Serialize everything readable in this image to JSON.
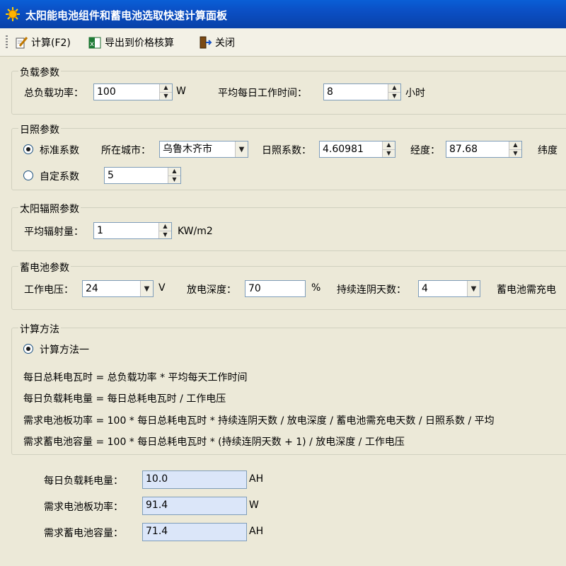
{
  "window": {
    "title": "太阳能电池组件和蓄电池选取快速计算面板"
  },
  "toolbar": {
    "calc_label": "计算(F2)",
    "export_label": "导出到价格核算",
    "close_label": "关闭"
  },
  "load": {
    "group_title": "负载参数",
    "total_power_label": "总负载功率：",
    "total_power_value": "100",
    "total_power_unit": "W",
    "daily_hours_label": "平均每日工作时间：",
    "daily_hours_value": "8",
    "daily_hours_unit": "小时"
  },
  "sunshine": {
    "group_title": "日照参数",
    "standard_label": "标准系数",
    "city_label": "所在城市：",
    "city_value": "乌鲁木齐市",
    "coef_label": "日照系数：",
    "coef_value": "4.60981",
    "longitude_label": "经度：",
    "longitude_value": "87.68",
    "latitude_label": "纬度",
    "custom_label": "自定系数",
    "custom_value": "5"
  },
  "radiation": {
    "group_title": "太阳辐照参数",
    "avg_label": "平均辐射量：",
    "avg_value": "1",
    "avg_unit": "KW/m2"
  },
  "battery": {
    "group_title": "蓄电池参数",
    "voltage_label": "工作电压：",
    "voltage_value": "24",
    "voltage_unit": "V",
    "depth_label": "放电深度：",
    "depth_value": "70",
    "depth_unit": "%",
    "cloudy_label": "持续连阴天数：",
    "cloudy_value": "4",
    "charge_label": "蓄电池需充电"
  },
  "method": {
    "group_title": "计算方法",
    "option1_label": "计算方法一",
    "formula1": "每日总耗电瓦时 = 总负载功率 * 平均每天工作时间",
    "formula2": "每日负载耗电量 = 每日总耗电瓦时 / 工作电压",
    "formula3": "需求电池板功率 = 100 * 每日总耗电瓦时 * 持续连阴天数 / 放电深度 / 蓄电池需充电天数 / 日照系数 / 平均",
    "formula4": "需求蓄电池容量 = 100 * 每日总耗电瓦时 * (持续连阴天数 + 1) / 放电深度 / 工作电压"
  },
  "results": {
    "daily_load_label": "每日负载耗电量：",
    "daily_load_value": "10.0",
    "daily_load_unit": "AH",
    "panel_power_label": "需求电池板功率：",
    "panel_power_value": "91.4",
    "panel_power_unit": "W",
    "battery_capacity_label": "需求蓄电池容量：",
    "battery_capacity_value": "71.4",
    "battery_capacity_unit": "AH"
  }
}
